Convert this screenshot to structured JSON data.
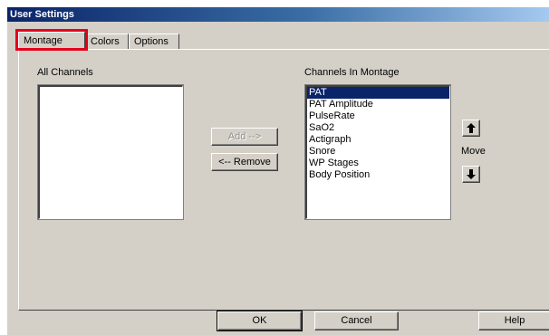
{
  "window": {
    "title": "User Settings"
  },
  "tabs": [
    {
      "label": "Montage",
      "active": true
    },
    {
      "label": "Colors",
      "active": false
    },
    {
      "label": "Options",
      "active": false
    }
  ],
  "all_channels": {
    "label": "All Channels",
    "items": []
  },
  "montage_channels": {
    "label": "Channels In Montage",
    "items": [
      "PAT",
      "PAT Amplitude",
      "PulseRate",
      "SaO2",
      "Actigraph",
      "Snore",
      "WP Stages",
      "Body Position"
    ],
    "selected_index": 0
  },
  "buttons": {
    "add": "Add -->",
    "remove": "<-- Remove",
    "move_label": "Move",
    "ok": "OK",
    "cancel": "Cancel",
    "help": "Help"
  },
  "icons": {
    "move_up": "arrow-up-icon",
    "move_down": "arrow-down-icon"
  },
  "colors": {
    "title_bar": "#0a246a",
    "selection": "#0a246a",
    "highlight_box": "#e3001b",
    "face": "#d4d0c8"
  }
}
